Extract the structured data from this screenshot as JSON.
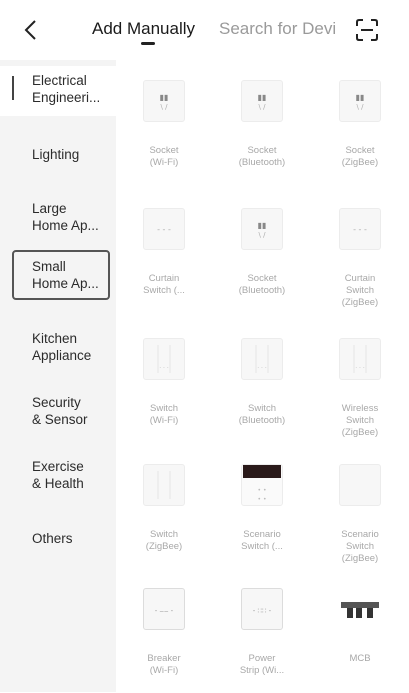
{
  "header": {
    "back_icon": "chevron-left-icon",
    "tabs": [
      {
        "label": "Add Manually",
        "active": true
      },
      {
        "label": "Search for Devi",
        "active": false
      }
    ],
    "scan_icon": "scan-icon"
  },
  "sidebar": {
    "items": [
      {
        "label_line1": "Electrical",
        "label_line2": "Engineeri...",
        "state": "active"
      },
      {
        "label_line1": "Lighting",
        "label_line2": ""
      },
      {
        "label_line1": "Large",
        "label_line2": "Home Ap..."
      },
      {
        "label_line1": "Small",
        "label_line2": "Home Ap...",
        "state": "highlighted"
      },
      {
        "label_line1": "Kitchen",
        "label_line2": "Appliance"
      },
      {
        "label_line1": "Security",
        "label_line2": "& Sensor"
      },
      {
        "label_line1": "Exercise",
        "label_line2": "& Health"
      },
      {
        "label_line1": "Others",
        "label_line2": ""
      }
    ]
  },
  "devices": [
    {
      "line1": "Socket",
      "line2": "(Wi-Fi)",
      "line3": "",
      "icon": "socket-icon"
    },
    {
      "line1": "Socket",
      "line2": "(Bluetooth)",
      "line3": "",
      "icon": "socket-icon"
    },
    {
      "line1": "Socket",
      "line2": "(ZigBee)",
      "line3": "",
      "icon": "socket-icon"
    },
    {
      "line1": "Curtain",
      "line2": "Switch (...",
      "line3": "",
      "icon": "curtain-switch-icon"
    },
    {
      "line1": "Socket",
      "line2": "(Bluetooth)",
      "line3": "",
      "icon": "socket-icon"
    },
    {
      "line1": "Curtain",
      "line2": "Switch",
      "line3": "(ZigBee)",
      "icon": "curtain-switch-icon"
    },
    {
      "line1": "Switch",
      "line2": "(Wi-Fi)",
      "line3": "",
      "icon": "wall-switch-icon"
    },
    {
      "line1": "Switch",
      "line2": "(Bluetooth)",
      "line3": "",
      "icon": "wall-switch-icon"
    },
    {
      "line1": "Wireless",
      "line2": "Switch",
      "line3": "(ZigBee)",
      "icon": "wireless-switch-icon"
    },
    {
      "line1": "Switch",
      "line2": "(ZigBee)",
      "line3": "",
      "icon": "wall-switch-icon"
    },
    {
      "line1": "Scenario",
      "line2": "Switch (...",
      "line3": "",
      "icon": "scenario-switch-icon"
    },
    {
      "line1": "Scenario",
      "line2": "Switch",
      "line3": "(ZigBee)",
      "icon": "scenario-switch-icon"
    },
    {
      "line1": "Breaker",
      "line2": "(Wi-Fi)",
      "line3": "",
      "icon": "breaker-icon"
    },
    {
      "line1": "Power",
      "line2": "Strip (Wi...",
      "line3": "",
      "icon": "power-strip-icon"
    },
    {
      "line1": "MCB",
      "line2": "",
      "line3": "",
      "icon": "mcb-icon"
    }
  ]
}
